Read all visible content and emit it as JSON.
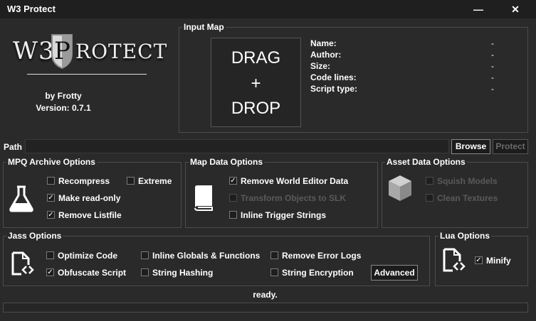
{
  "window": {
    "title": "W3 Protect",
    "minimize_glyph": "—",
    "close_glyph": "✕"
  },
  "logo": {
    "left_text": "W3",
    "right_text": "ROTECT",
    "shield_letter": "P",
    "byline": "by Frotty",
    "version": "Version: 0.7.1"
  },
  "input_map": {
    "legend": "Input Map",
    "drop_line1": "DRAG",
    "drop_line2": "+",
    "drop_line3": "DROP",
    "fields": [
      {
        "label": "Name:",
        "value": "-"
      },
      {
        "label": "Author:",
        "value": "-"
      },
      {
        "label": "Size:",
        "value": "-"
      },
      {
        "label": "Code lines:",
        "value": "-"
      },
      {
        "label": "Script type:",
        "value": "-"
      }
    ]
  },
  "path": {
    "label": "Path",
    "value": "",
    "browse_label": "Browse",
    "protect_label": "Protect"
  },
  "mpq": {
    "legend": "MPQ Archive Options",
    "icon": "flask-icon",
    "options": [
      {
        "label": "Recompress",
        "checked": false
      },
      {
        "label": "Extreme",
        "checked": false
      },
      {
        "label": "Make read-only",
        "checked": true
      },
      {
        "label": "Remove Listfile",
        "checked": true
      }
    ]
  },
  "mapdata": {
    "legend": "Map Data Options",
    "icon": "book-icon",
    "options": [
      {
        "label": "Remove World Editor Data",
        "checked": true
      },
      {
        "label": "Transform Objects to SLK",
        "checked": false,
        "disabled": true
      },
      {
        "label": "Inline Trigger Strings",
        "checked": false
      }
    ]
  },
  "asset": {
    "legend": "Asset Data Options",
    "icon": "cube-icon",
    "options": [
      {
        "label": "Squish Models",
        "checked": false,
        "disabled": true
      },
      {
        "label": "Clean Textures",
        "checked": false,
        "disabled": true
      }
    ]
  },
  "jass": {
    "legend": "Jass Options",
    "icon": "script-file-icon",
    "options": [
      {
        "label": "Optimize Code",
        "checked": false
      },
      {
        "label": "Inline Globals & Functions",
        "checked": false
      },
      {
        "label": "Remove Error Logs",
        "checked": false
      },
      {
        "label": "Obfuscate Script",
        "checked": true
      },
      {
        "label": "String Hashing",
        "checked": false
      },
      {
        "label": "String Encryption",
        "checked": false
      }
    ],
    "advanced_label": "Advanced"
  },
  "lua": {
    "legend": "Lua Options",
    "icon": "script-file-icon",
    "options": [
      {
        "label": "Minify",
        "checked": true
      }
    ]
  },
  "status": {
    "text": "ready.",
    "progress": 0
  },
  "colors": {
    "background": "#2a2a2a",
    "titlebar": "#1f1f1f",
    "border": "#4c4c4c"
  }
}
